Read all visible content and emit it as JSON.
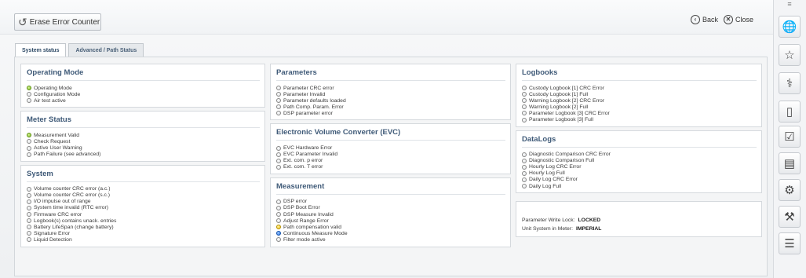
{
  "toolbar": {
    "erase_label": "Erase Error Counter",
    "back_label": "Back",
    "close_label": "Close"
  },
  "tabs": [
    {
      "label": "System status",
      "active": true
    },
    {
      "label": "Advanced / Path Status",
      "active": false
    }
  ],
  "right_icons": [
    "globe-gear-icon",
    "star-icon",
    "stethoscope-icon",
    "book-icon",
    "checklist-icon",
    "document-icon",
    "settings-icon",
    "wrench-icon",
    "list-icon"
  ],
  "operating_mode": {
    "title": "Operating Mode",
    "items": [
      {
        "label": "Operating Mode",
        "state": "green"
      },
      {
        "label": "Configuration Mode",
        "state": "off"
      },
      {
        "label": "Air test active",
        "state": "off"
      }
    ]
  },
  "meter_status": {
    "title": "Meter Status",
    "items": [
      {
        "label": "Measurement Valid",
        "state": "green"
      },
      {
        "label": "Check Request",
        "state": "off"
      },
      {
        "label": "Active User Warning",
        "state": "off"
      },
      {
        "label": "Path Failure (see advanced)",
        "state": "off"
      }
    ]
  },
  "system": {
    "title": "System",
    "items": [
      {
        "label": "Volume counter CRC error (a.c.)",
        "state": "off"
      },
      {
        "label": "Volume counter CRC error (s.c.)",
        "state": "off"
      },
      {
        "label": "I/O impulse out of range",
        "state": "off"
      },
      {
        "label": "System time invalid (RTC error)",
        "state": "off"
      },
      {
        "label": "Firmware CRC error",
        "state": "off"
      },
      {
        "label": "Logbook(s) contains unack. entries",
        "state": "off"
      },
      {
        "label": "Battery LifeSpan (change battery)",
        "state": "off"
      },
      {
        "label": "Signature Error",
        "state": "off"
      },
      {
        "label": "Liquid Detection",
        "state": "off"
      }
    ]
  },
  "parameters": {
    "title": "Parameters",
    "items": [
      {
        "label": "Parameter CRC error",
        "state": "off"
      },
      {
        "label": "Parameter Invalid",
        "state": "off"
      },
      {
        "label": "Parameter defaults loaded",
        "state": "off"
      },
      {
        "label": "Path Comp. Param. Error",
        "state": "off"
      },
      {
        "label": "DSP parameter error",
        "state": "off"
      }
    ]
  },
  "evc": {
    "title": "Electronic Volume Converter (EVC)",
    "items": [
      {
        "label": "EVC Hardware Error",
        "state": "off"
      },
      {
        "label": "EVC Parameter Invalid",
        "state": "off"
      },
      {
        "label": "Ext. com. p error",
        "state": "off"
      },
      {
        "label": "Ext. com. T error",
        "state": "off"
      }
    ]
  },
  "measurement": {
    "title": "Measurement",
    "items": [
      {
        "label": "DSP error",
        "state": "off"
      },
      {
        "label": "DSP Boot Error",
        "state": "off"
      },
      {
        "label": "DSP Measure Invalid",
        "state": "off"
      },
      {
        "label": "Adjust Range Error",
        "state": "off"
      },
      {
        "label": "Path compensation valid",
        "state": "yellow"
      },
      {
        "label": "Continuous Measure Mode",
        "state": "blue"
      },
      {
        "label": "Filter mode active",
        "state": "off"
      }
    ]
  },
  "logbooks": {
    "title": "Logbooks",
    "items": [
      {
        "label": "Custody Logbook [1] CRC Error",
        "state": "off"
      },
      {
        "label": "Custody Logbook [1] Full",
        "state": "off"
      },
      {
        "label": "Warning Logbook [2] CRC Error",
        "state": "off"
      },
      {
        "label": "Warning Logbook [2] Full",
        "state": "off"
      },
      {
        "label": "Parameter Logbook [3] CRC Error",
        "state": "off"
      },
      {
        "label": "Parameter Logbook [3]  Full",
        "state": "off"
      }
    ]
  },
  "datalogs": {
    "title": "DataLogs",
    "items": [
      {
        "label": "Diagnostic Comparison CRC Error",
        "state": "off"
      },
      {
        "label": "Diagnostic Comparison Full",
        "state": "off"
      },
      {
        "label": "Hourly Log CRC Error",
        "state": "off"
      },
      {
        "label": "Hourly Log Full",
        "state": "off"
      },
      {
        "label": "Daily Log CRC Error",
        "state": "off"
      },
      {
        "label": "Daily Log Full",
        "state": "off"
      }
    ]
  },
  "status_info": {
    "write_lock_label": "Parameter Write Lock:",
    "write_lock_value": "LOCKED",
    "unit_system_label": "Unit System in Meter:",
    "unit_system_value": "IMPERIAL"
  }
}
